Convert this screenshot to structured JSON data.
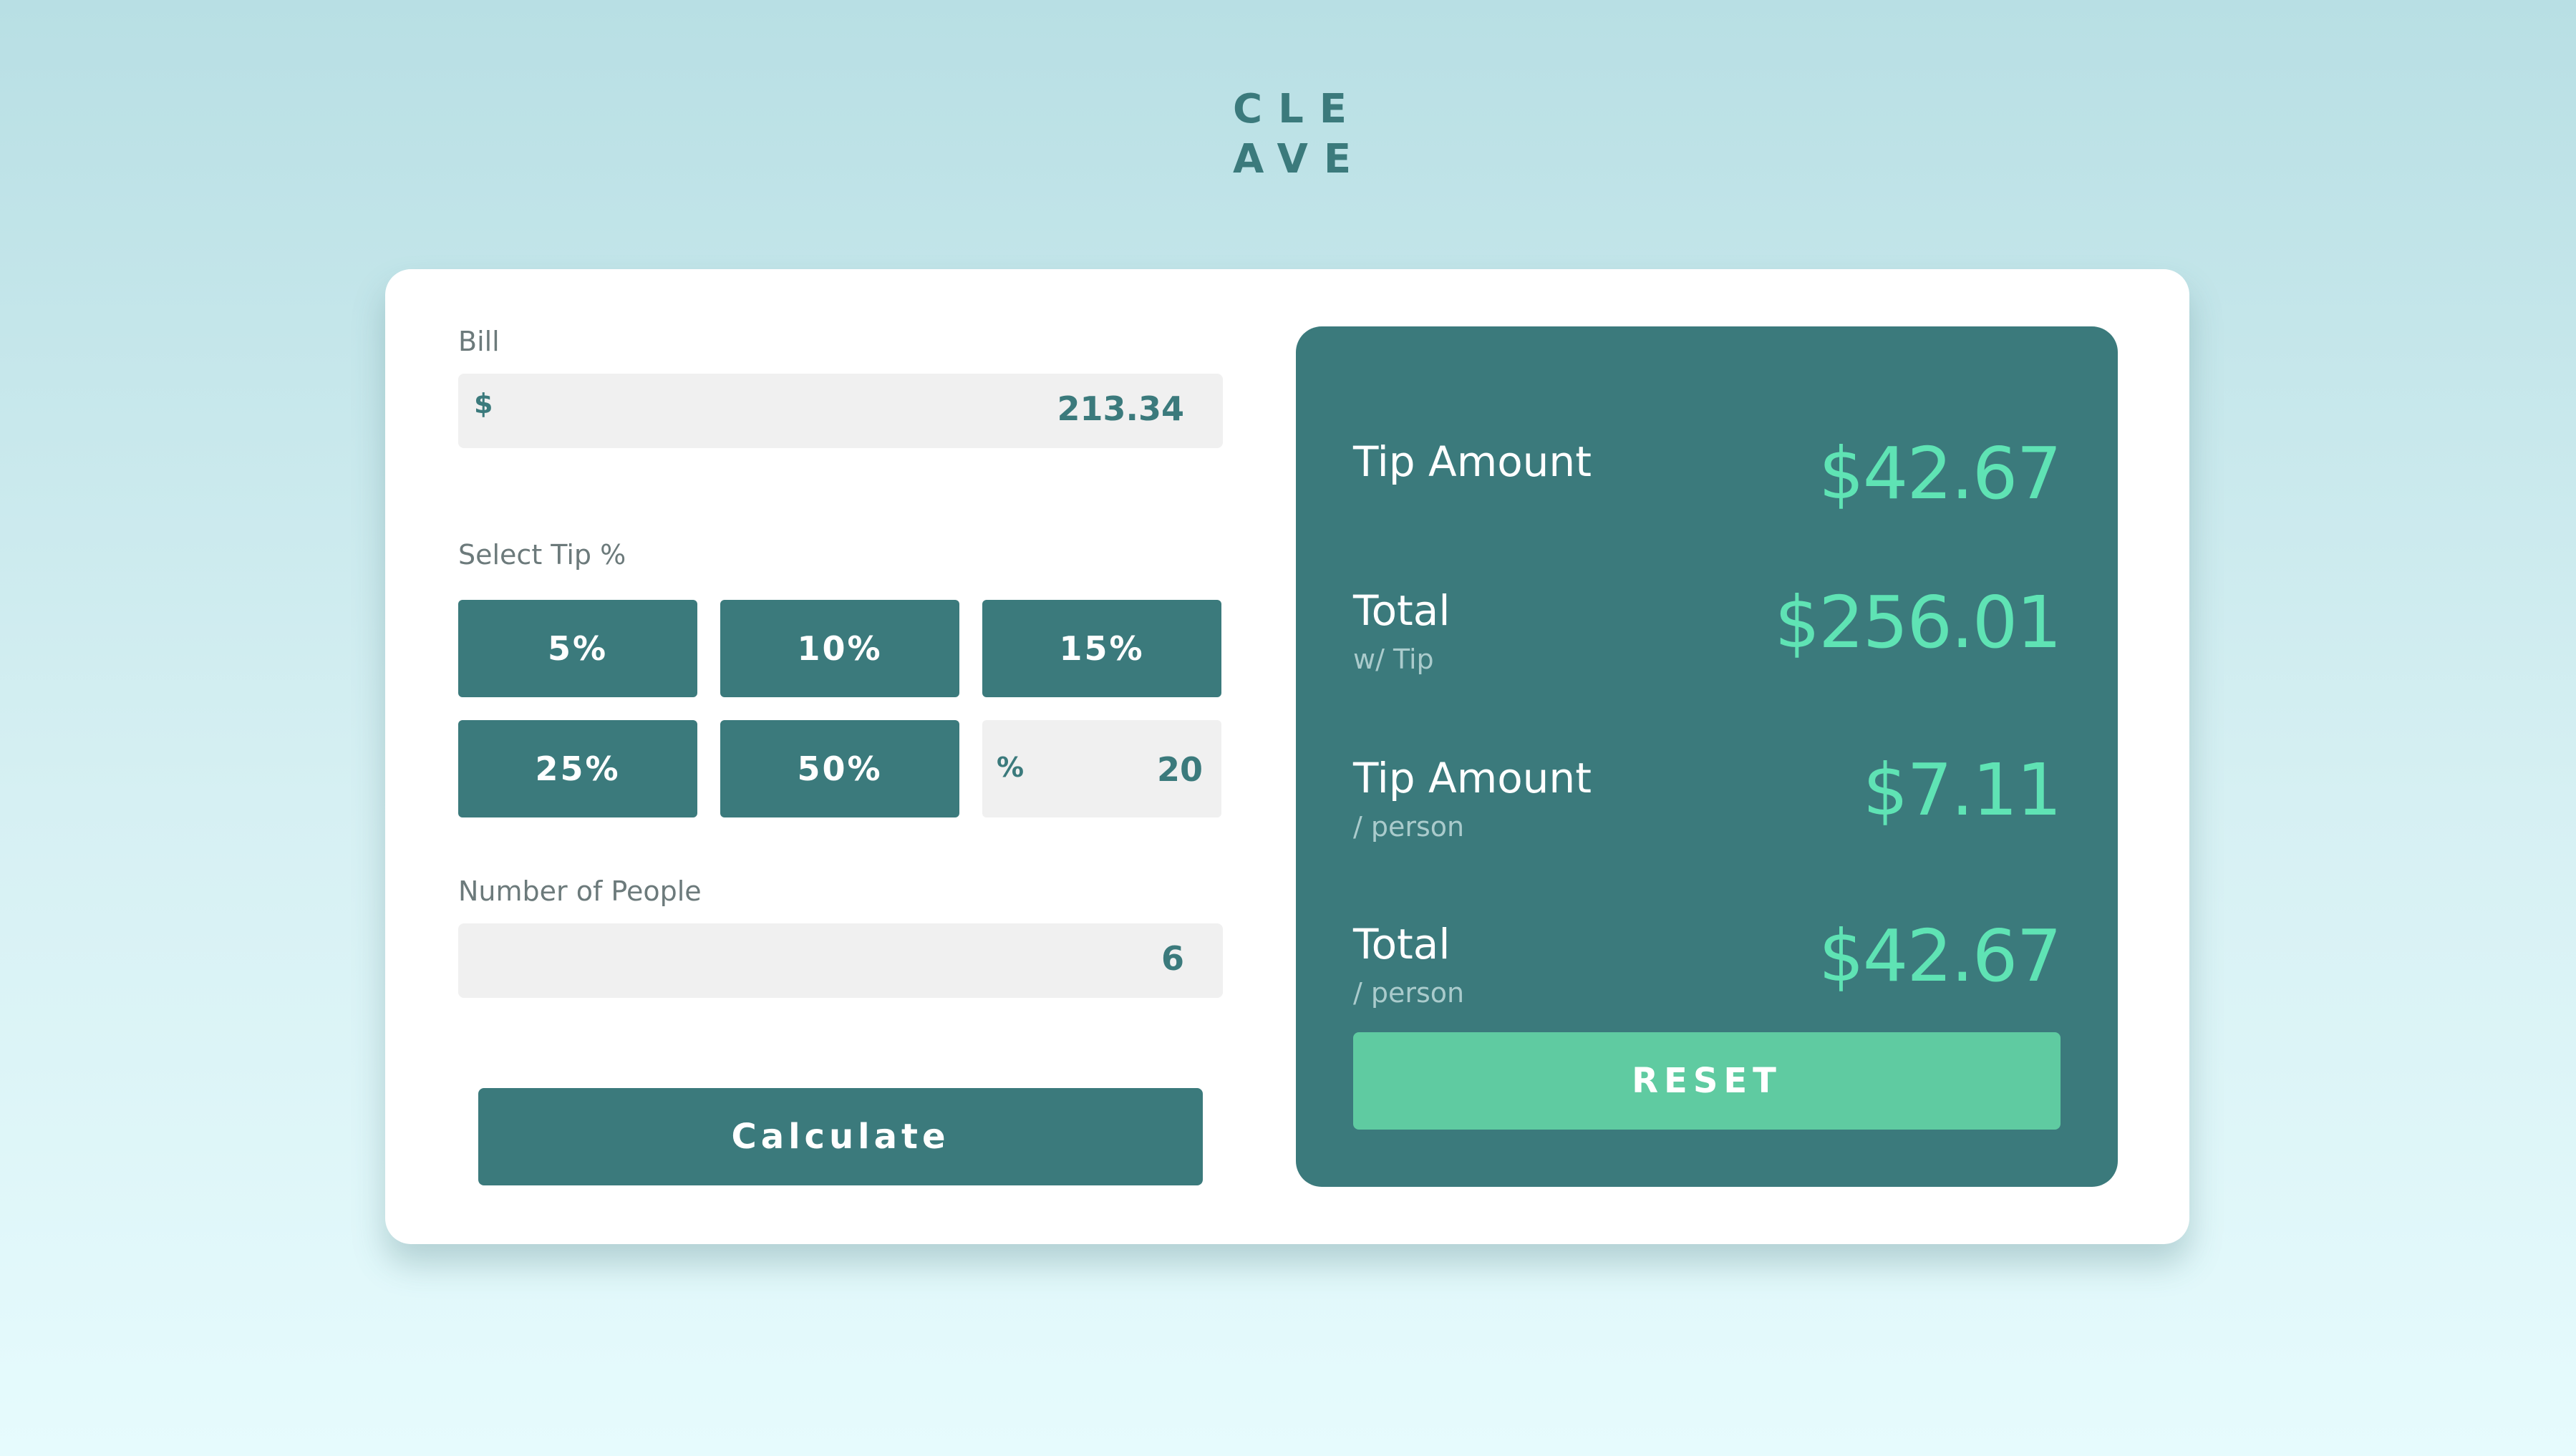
{
  "logo": {
    "line1": "CLE",
    "line2": "AVE"
  },
  "bill": {
    "label": "Bill",
    "currency_symbol": "$",
    "value": "213.34"
  },
  "tip": {
    "label": "Select Tip %",
    "options": [
      "5%",
      "10%",
      "15%",
      "25%",
      "50%"
    ],
    "custom_symbol": "%",
    "custom_value": "20"
  },
  "people": {
    "label": "Number of People",
    "value": "6"
  },
  "calculate_label": "Calculate",
  "results": {
    "tip_amount": {
      "title": "Tip Amount",
      "value": "$42.67"
    },
    "total_with_tip": {
      "title": "Total",
      "subtitle": "w/ Tip",
      "value": "$256.01"
    },
    "tip_per_person": {
      "title": "Tip Amount",
      "subtitle": "/ person",
      "value": "$7.11"
    },
    "total_per_person": {
      "title": "Total",
      "subtitle": "/ person",
      "value": "$42.67"
    }
  },
  "reset_label": "RESET",
  "colors": {
    "primary": "#3b7a7c",
    "accent": "#5fe3b4",
    "reset": "#5fcba1",
    "input_bg": "#f0f0f0"
  }
}
